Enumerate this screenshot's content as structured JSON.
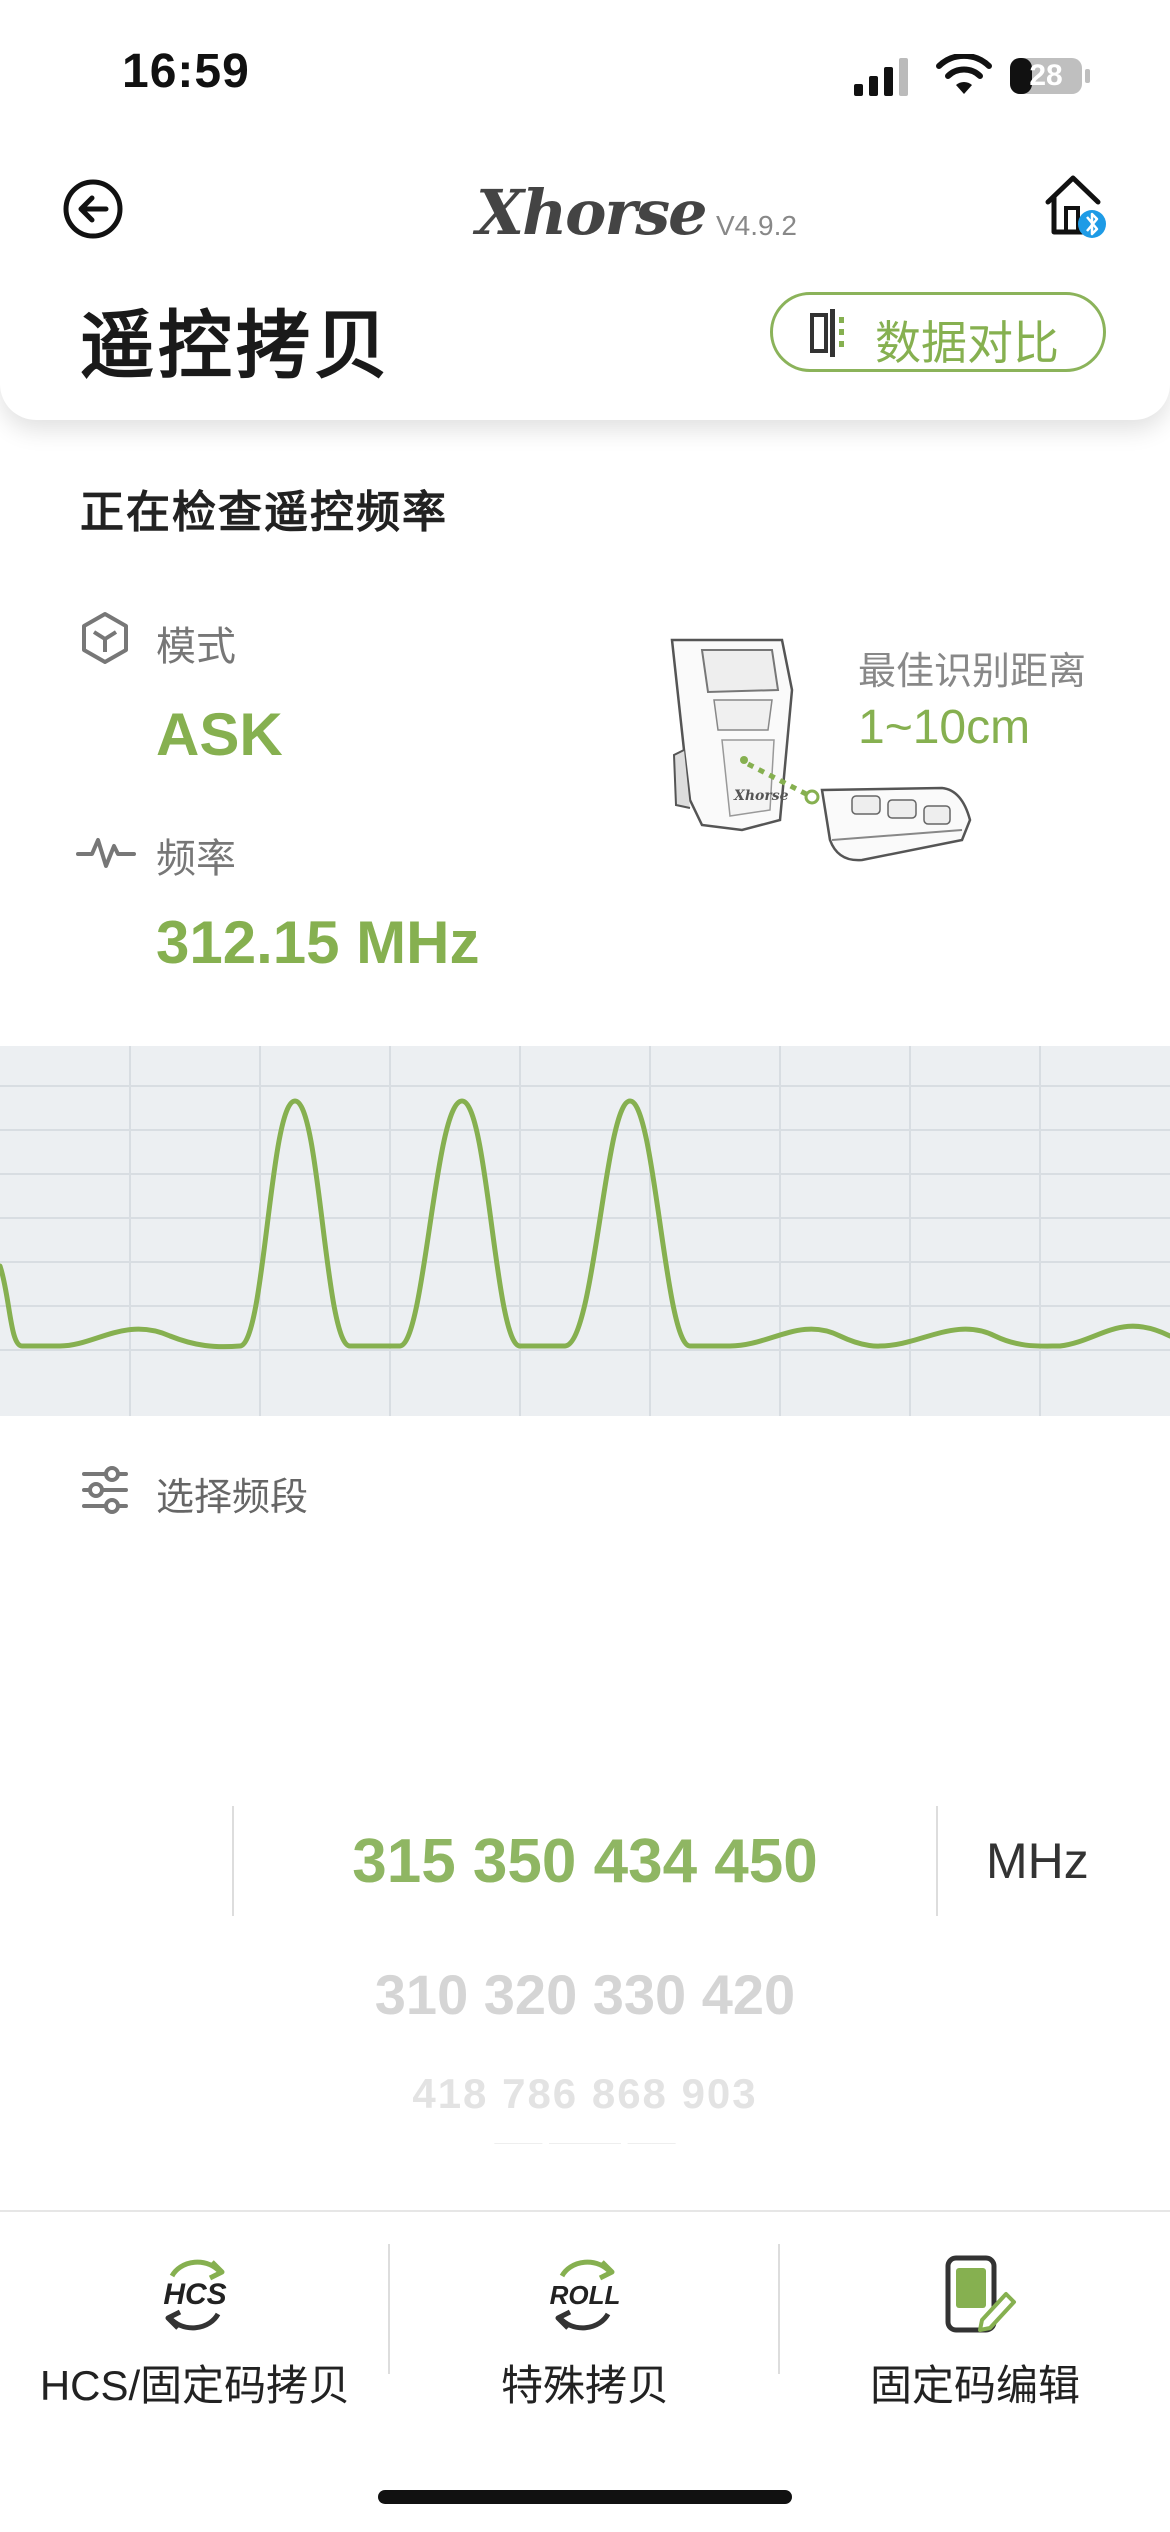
{
  "status_bar": {
    "time": "16:59",
    "battery": "28"
  },
  "header": {
    "brand": "Xhorse",
    "version": "V4.9.2",
    "title": "遥控拷贝",
    "compare_button_label": "数据对比"
  },
  "detection": {
    "status_text": "正在检查遥控频率",
    "mode_label": "模式",
    "mode_value": "ASK",
    "frequency_label": "频率",
    "frequency_value": "312.15 MHz",
    "best_distance_label": "最佳识别距离",
    "best_distance_value": "1~10cm"
  },
  "band_selector": {
    "label": "选择频段",
    "rows": [
      "315 350 434 450",
      "310 320 330 420",
      "418 786 868 903",
      "—— ——— ——"
    ],
    "unit": "MHz"
  },
  "toolbar": {
    "items": [
      {
        "icon": "hcs-icon",
        "icon_text": "HCS",
        "label": "HCS/固定码拷贝"
      },
      {
        "icon": "roll-icon",
        "icon_text": "ROLL",
        "label": "特殊拷贝"
      },
      {
        "icon": "fixed-code-edit-icon",
        "label": "固定码编辑"
      }
    ]
  },
  "colors": {
    "accent": "#86b050",
    "waveform_bg": "#eceff2",
    "grid": "#d8dde2"
  }
}
